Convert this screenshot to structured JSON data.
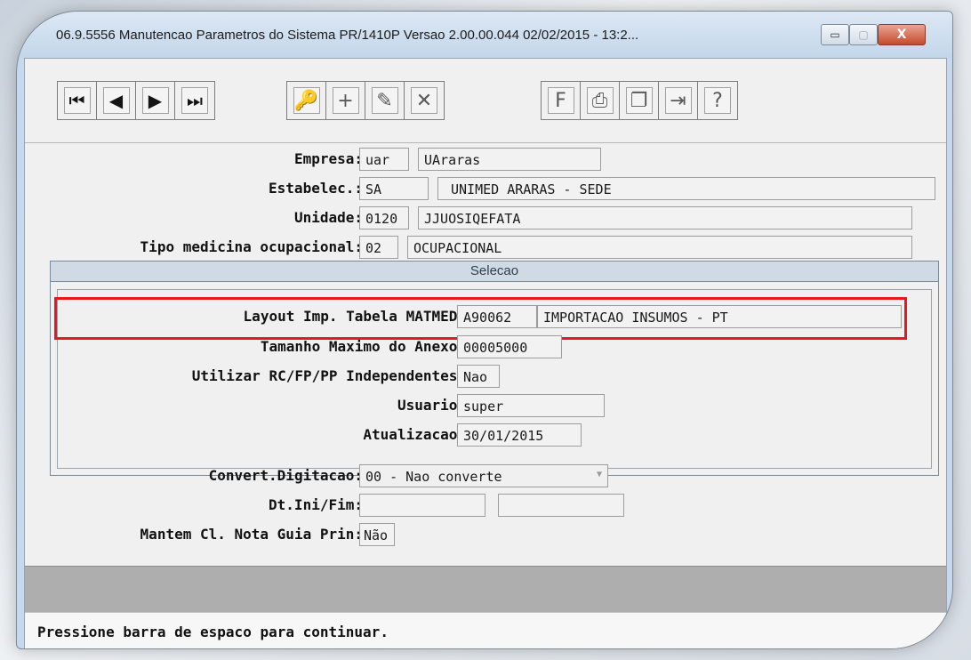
{
  "window": {
    "title": "06.9.5556 Manutencao  Parametros do Sistema PR/1410P Versao 2.00.00.044 02/02/2015 - 13:2...",
    "controls": {
      "minimize": "▭",
      "maximize": "▢",
      "close": "X"
    }
  },
  "toolbar": {
    "nav": [
      {
        "name": "first-record-icon",
        "glyph": "⏮"
      },
      {
        "name": "previous-record-icon",
        "glyph": "◀"
      },
      {
        "name": "next-record-icon",
        "glyph": "▶"
      },
      {
        "name": "last-record-icon",
        "glyph": "⏭"
      }
    ],
    "edit": [
      {
        "name": "search-key-icon",
        "glyph": "🔑"
      },
      {
        "name": "add-record-icon",
        "glyph": "+"
      },
      {
        "name": "modify-record-icon",
        "glyph": "✎"
      },
      {
        "name": "delete-record-icon",
        "glyph": "✕"
      }
    ],
    "tools": [
      {
        "name": "filter-icon",
        "glyph": "F"
      },
      {
        "name": "print-icon",
        "glyph": "⎙"
      },
      {
        "name": "copy-icon",
        "glyph": "❐"
      },
      {
        "name": "exit-icon",
        "glyph": "⇥"
      },
      {
        "name": "help-icon",
        "glyph": "?"
      }
    ]
  },
  "form": {
    "empresa": {
      "label": "Empresa:",
      "code": "uar",
      "name": "UAraras"
    },
    "estabelec": {
      "label": "Estabelec.:",
      "code": "SA",
      "name": "UNIMED ARARAS - SEDE"
    },
    "unidade": {
      "label": "Unidade:",
      "code": "0120",
      "name": "JJUOSIQEFATA"
    },
    "tipo_medicina": {
      "label": "Tipo medicina ocupacional:",
      "code": "02",
      "name": "OCUPACIONAL"
    },
    "selecao": {
      "title": "Selecao",
      "layout_imp": {
        "label": "Layout Imp. Tabela MATMED:",
        "code": "A90062",
        "name": "IMPORTACAO INSUMOS - PT"
      },
      "tamanho_max": {
        "label": "Tamanho Maximo do Anexo:",
        "value": "00005000"
      },
      "utilizar_rc": {
        "label": "Utilizar RC/FP/PP Independentes:",
        "value": "Nao"
      },
      "usuario": {
        "label": "Usuario:",
        "value": "super"
      },
      "atualizacao": {
        "label": "Atualizacao:",
        "value": "30/01/2015"
      }
    },
    "convert_digitacao": {
      "label": "Convert.Digitacao:",
      "value": "00 - Nao converte"
    },
    "dt_ini_fim": {
      "label": "Dt.Ini/Fim:",
      "ini": "",
      "fim": ""
    },
    "mantem_cl": {
      "label": "Mantem Cl. Nota Guia Prin:",
      "value": "Não"
    }
  },
  "status": {
    "message": "Pressione barra de espaco para continuar."
  },
  "colors": {
    "highlight": "#e8181c",
    "group_header": "#d0dae4"
  }
}
